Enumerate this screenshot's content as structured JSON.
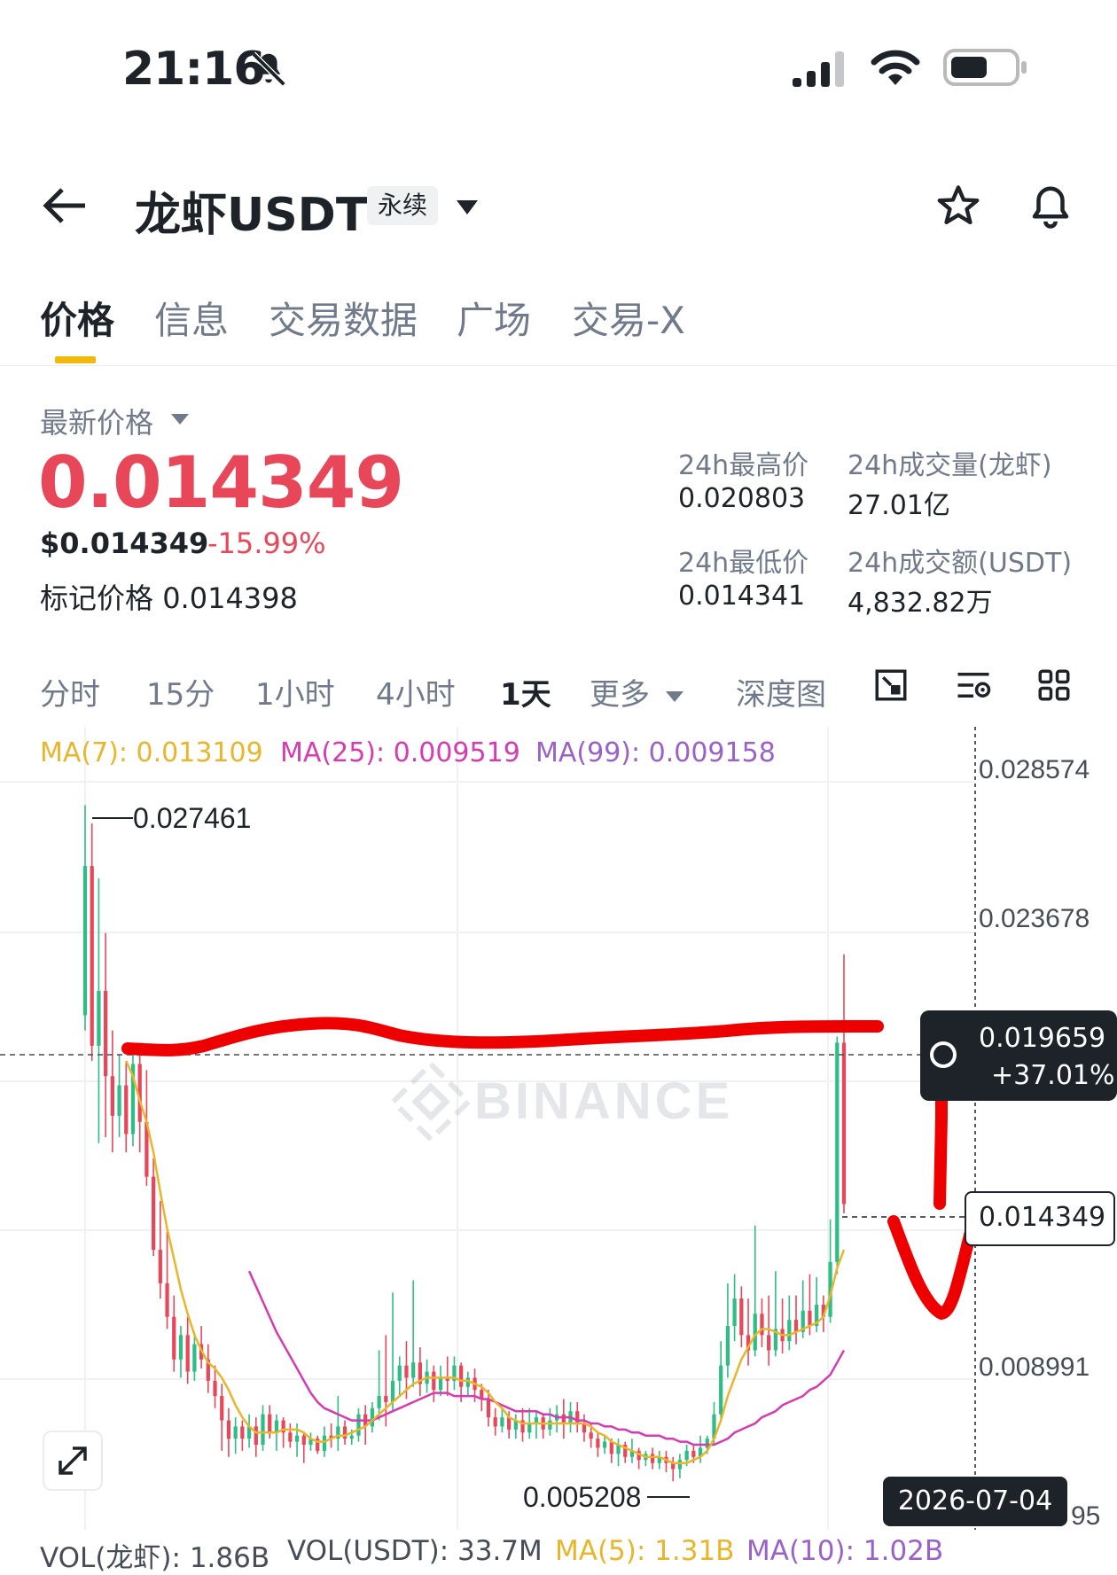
{
  "status_bar": {
    "time": "21:16"
  },
  "header": {
    "title": "龙虾USDT",
    "badge": "永续"
  },
  "tabs": [
    {
      "label": "价格",
      "active": true
    },
    {
      "label": "信息"
    },
    {
      "label": "交易数据"
    },
    {
      "label": "广场"
    },
    {
      "label": "交易-X"
    }
  ],
  "price": {
    "latest_label": "最新价格",
    "last": "0.014349",
    "usd": "$0.014349",
    "change": "-15.99%",
    "mark_label": "标记价格",
    "mark_value": "0.014398"
  },
  "stats": {
    "high_label": "24h最高价",
    "high": "0.020803",
    "vol_coin_label": "24h成交量(龙虾)",
    "vol_coin": "27.01亿",
    "low_label": "24h最低价",
    "low": "0.014341",
    "vol_usdt_label": "24h成交额(USDT)",
    "vol_usdt": "4,832.82万"
  },
  "intervals": [
    "分时",
    "15分",
    "1小时",
    "4小时",
    "1天",
    "更多",
    "深度图"
  ],
  "selected_interval": "1天",
  "chart_labels": {
    "ma7": "MA(7): 0.013109",
    "ma25": "MA(25): 0.009519",
    "ma99": "MA(99): 0.009158",
    "watermark": "BINANCE",
    "high_marker": "0.027461",
    "low_marker": "0.005208",
    "crosshair_price": "0.019659",
    "crosshair_pct": "+37.01%",
    "last_price": "0.014349",
    "date": "2026-07-04",
    "y_ticks": [
      "0.028574",
      "0.023678",
      "0.008991",
      "95"
    ],
    "vol_coin": "VOL(龙虾): 1.86B",
    "vol_usdt": "VOL(USDT): 33.7M",
    "vol_ma5": "MA(5): 1.31B",
    "vol_ma10": "MA(10): 1.02B"
  },
  "colors": {
    "up": "#2ebd85",
    "down": "#e8475a",
    "ma7": "#e9b52b",
    "ma25": "#d63bb0",
    "ma99": "#9a61c9",
    "accent": "#f0b90b",
    "annotation": "#ee0000"
  },
  "chart_data": {
    "type": "candlestick",
    "y_axis_ticks": [
      0.028574,
      0.023678,
      0.008991
    ],
    "high_marker": 0.027461,
    "low_marker": 0.005208,
    "crosshair": 0.019659,
    "last": 0.014349,
    "candles": [
      [
        0.0205,
        0.0254,
        0.02,
        0.0274
      ],
      [
        0.0254,
        0.0195,
        0.019,
        0.0268
      ],
      [
        0.0195,
        0.0213,
        0.0163,
        0.025
      ],
      [
        0.0213,
        0.0185,
        0.0165,
        0.0232
      ],
      [
        0.0185,
        0.0172,
        0.016,
        0.02
      ],
      [
        0.0172,
        0.0182,
        0.0165,
        0.0192
      ],
      [
        0.0182,
        0.0166,
        0.016,
        0.019
      ],
      [
        0.0166,
        0.0189,
        0.0162,
        0.0196
      ],
      [
        0.0189,
        0.017,
        0.016,
        0.0194
      ],
      [
        0.017,
        0.0152,
        0.0149,
        0.0187
      ],
      [
        0.0152,
        0.0128,
        0.0126,
        0.0158
      ],
      [
        0.0128,
        0.0117,
        0.0112,
        0.0144
      ],
      [
        0.0117,
        0.0106,
        0.0102,
        0.0134
      ],
      [
        0.0106,
        0.0092,
        0.0088,
        0.0113
      ],
      [
        0.0092,
        0.01,
        0.0086,
        0.0103
      ],
      [
        0.01,
        0.0088,
        0.0084,
        0.0106
      ],
      [
        0.0088,
        0.0097,
        0.0085,
        0.0101
      ],
      [
        0.0097,
        0.0092,
        0.0089,
        0.0103
      ],
      [
        0.0092,
        0.0085,
        0.0081,
        0.0097
      ],
      [
        0.0085,
        0.008,
        0.0076,
        0.009
      ],
      [
        0.008,
        0.0072,
        0.0062,
        0.0084
      ],
      [
        0.0072,
        0.0066,
        0.006,
        0.0076
      ],
      [
        0.0066,
        0.007,
        0.0061,
        0.0073
      ],
      [
        0.007,
        0.0066,
        0.0062,
        0.0072
      ],
      [
        0.0066,
        0.007,
        0.0063,
        0.0074
      ],
      [
        0.007,
        0.0064,
        0.006,
        0.0073
      ],
      [
        0.0064,
        0.0074,
        0.0062,
        0.0077
      ],
      [
        0.0074,
        0.0068,
        0.0066,
        0.0077
      ],
      [
        0.0068,
        0.0072,
        0.0062,
        0.0074
      ],
      [
        0.0072,
        0.0068,
        0.0063,
        0.0073
      ],
      [
        0.0068,
        0.0065,
        0.0063,
        0.0071
      ],
      [
        0.0065,
        0.0067,
        0.006,
        0.0071
      ],
      [
        0.0067,
        0.0064,
        0.0058,
        0.0068
      ],
      [
        0.0064,
        0.0066,
        0.0062,
        0.0068
      ],
      [
        0.0066,
        0.0062,
        0.0061,
        0.0067
      ],
      [
        0.0062,
        0.0067,
        0.006,
        0.007
      ],
      [
        0.0067,
        0.0066,
        0.0063,
        0.0071
      ],
      [
        0.0066,
        0.007,
        0.0062,
        0.008
      ],
      [
        0.007,
        0.0066,
        0.0064,
        0.0072
      ],
      [
        0.0066,
        0.0067,
        0.0064,
        0.0069
      ],
      [
        0.0067,
        0.0074,
        0.0065,
        0.0076
      ],
      [
        0.0074,
        0.007,
        0.0064,
        0.0077
      ],
      [
        0.007,
        0.0076,
        0.0068,
        0.0078
      ],
      [
        0.0076,
        0.008,
        0.0072,
        0.0095
      ],
      [
        0.008,
        0.0078,
        0.007,
        0.01
      ],
      [
        0.0078,
        0.0085,
        0.0075,
        0.0114
      ],
      [
        0.0085,
        0.009,
        0.008,
        0.0093
      ],
      [
        0.009,
        0.0086,
        0.0079,
        0.0098
      ],
      [
        0.0086,
        0.0091,
        0.0083,
        0.0118
      ],
      [
        0.0091,
        0.0084,
        0.008,
        0.0096
      ],
      [
        0.0084,
        0.0088,
        0.0081,
        0.0092
      ],
      [
        0.0088,
        0.0082,
        0.0078,
        0.009
      ],
      [
        0.0082,
        0.0086,
        0.008,
        0.009
      ],
      [
        0.0086,
        0.0085,
        0.008,
        0.0093
      ],
      [
        0.0085,
        0.009,
        0.0082,
        0.0093
      ],
      [
        0.009,
        0.0083,
        0.0078,
        0.0091
      ],
      [
        0.0083,
        0.0086,
        0.008,
        0.0088
      ],
      [
        0.0086,
        0.0082,
        0.0078,
        0.0089
      ],
      [
        0.0082,
        0.0079,
        0.0075,
        0.0084
      ],
      [
        0.0079,
        0.0073,
        0.007,
        0.0082
      ],
      [
        0.0073,
        0.007,
        0.0067,
        0.0076
      ],
      [
        0.007,
        0.0073,
        0.0068,
        0.0076
      ],
      [
        0.0073,
        0.0069,
        0.0066,
        0.0075
      ],
      [
        0.0069,
        0.0072,
        0.0066,
        0.0074
      ],
      [
        0.0072,
        0.0068,
        0.0065,
        0.0076
      ],
      [
        0.0068,
        0.0071,
        0.0066,
        0.0076
      ],
      [
        0.0071,
        0.0073,
        0.0066,
        0.0075
      ],
      [
        0.0073,
        0.0069,
        0.0066,
        0.0074
      ],
      [
        0.0069,
        0.0072,
        0.0067,
        0.0076
      ],
      [
        0.0072,
        0.0074,
        0.0068,
        0.0077
      ],
      [
        0.0074,
        0.0071,
        0.0066,
        0.0079
      ],
      [
        0.0071,
        0.0075,
        0.0068,
        0.0078
      ],
      [
        0.0075,
        0.0071,
        0.0068,
        0.0078
      ],
      [
        0.0071,
        0.0068,
        0.0065,
        0.0074
      ],
      [
        0.0068,
        0.0066,
        0.0063,
        0.0071
      ],
      [
        0.0066,
        0.0063,
        0.006,
        0.0068
      ],
      [
        0.0063,
        0.0065,
        0.0061,
        0.0067
      ],
      [
        0.0065,
        0.0061,
        0.0058,
        0.0066
      ],
      [
        0.0061,
        0.0064,
        0.0057,
        0.0066
      ],
      [
        0.0064,
        0.006,
        0.0058,
        0.0065
      ],
      [
        0.006,
        0.0062,
        0.0058,
        0.0066
      ],
      [
        0.0062,
        0.0059,
        0.0056,
        0.0063
      ],
      [
        0.0059,
        0.0061,
        0.0057,
        0.0062
      ],
      [
        0.0061,
        0.0058,
        0.0056,
        0.0063
      ],
      [
        0.0058,
        0.006,
        0.0056,
        0.0062
      ],
      [
        0.006,
        0.0058,
        0.0055,
        0.0062
      ],
      [
        0.0058,
        0.0056,
        0.0052,
        0.006
      ],
      [
        0.0056,
        0.0059,
        0.0053,
        0.0061
      ],
      [
        0.0059,
        0.0062,
        0.0057,
        0.0064
      ],
      [
        0.0062,
        0.006,
        0.0058,
        0.0064
      ],
      [
        0.006,
        0.0063,
        0.0058,
        0.0067
      ],
      [
        0.0063,
        0.0066,
        0.0061,
        0.0067
      ],
      [
        0.0066,
        0.0074,
        0.0064,
        0.0078
      ],
      [
        0.0074,
        0.009,
        0.0072,
        0.0098
      ],
      [
        0.009,
        0.0103,
        0.0086,
        0.0117
      ],
      [
        0.0103,
        0.0112,
        0.0098,
        0.012
      ],
      [
        0.0112,
        0.01,
        0.0096,
        0.0116
      ],
      [
        0.01,
        0.0095,
        0.009,
        0.0112
      ],
      [
        0.0095,
        0.0107,
        0.0093,
        0.0136
      ],
      [
        0.0107,
        0.01,
        0.0096,
        0.0112
      ],
      [
        0.01,
        0.0095,
        0.009,
        0.0113
      ],
      [
        0.0095,
        0.0102,
        0.0093,
        0.0121
      ],
      [
        0.0102,
        0.0098,
        0.0094,
        0.0112
      ],
      [
        0.0098,
        0.0105,
        0.0095,
        0.0113
      ],
      [
        0.0105,
        0.0101,
        0.0097,
        0.0113
      ],
      [
        0.0101,
        0.0108,
        0.0099,
        0.0118
      ],
      [
        0.0108,
        0.0103,
        0.01,
        0.012
      ],
      [
        0.0103,
        0.011,
        0.0101,
        0.0119
      ],
      [
        0.011,
        0.0106,
        0.0101,
        0.0113
      ],
      [
        0.0106,
        0.0124,
        0.0104,
        0.0138
      ],
      [
        0.0124,
        0.0196,
        0.012,
        0.0198
      ],
      [
        0.0196,
        0.0143,
        0.014,
        0.0225
      ]
    ],
    "ma7": [
      null,
      null,
      null,
      null,
      null,
      null,
      0.019,
      0.0185,
      0.0177,
      0.017,
      0.016,
      0.0147,
      0.0135,
      0.0125,
      0.0115,
      0.0107,
      0.01,
      0.0095,
      0.0091,
      0.0089,
      0.0086,
      0.0082,
      0.0077,
      0.0073,
      0.007,
      0.0068,
      0.0068,
      0.0068,
      0.0068,
      0.0069,
      0.0069,
      0.0069,
      0.0068,
      0.0066,
      0.0065,
      0.0065,
      0.0066,
      0.0067,
      0.0067,
      0.0068,
      0.0069,
      0.007,
      0.0072,
      0.0074,
      0.0076,
      0.0078,
      0.008,
      0.0082,
      0.0084,
      0.0085,
      0.0086,
      0.0086,
      0.0086,
      0.0086,
      0.0086,
      0.0085,
      0.0085,
      0.0084,
      0.0083,
      0.0081,
      0.0078,
      0.0076,
      0.0073,
      0.0072,
      0.0071,
      0.0071,
      0.0071,
      0.0071,
      0.0071,
      0.0071,
      0.0071,
      0.0071,
      0.0071,
      0.0071,
      0.007,
      0.0068,
      0.0067,
      0.0065,
      0.0064,
      0.0063,
      0.0062,
      0.0061,
      0.006,
      0.006,
      0.006,
      0.0059,
      0.0058,
      0.0058,
      0.0058,
      0.0059,
      0.006,
      0.0062,
      0.0066,
      0.0072,
      0.008,
      0.0086,
      0.0092,
      0.0096,
      0.01,
      0.0102,
      0.0102,
      0.0101,
      0.01,
      0.01,
      0.0101,
      0.0102,
      0.0103,
      0.0104,
      0.0106,
      0.0113,
      0.0122,
      0.0128
    ],
    "ma25": [
      null,
      null,
      null,
      null,
      null,
      null,
      null,
      null,
      null,
      null,
      null,
      null,
      null,
      null,
      null,
      null,
      null,
      null,
      null,
      null,
      null,
      null,
      null,
      null,
      0.0121,
      0.0116,
      0.0111,
      0.0106,
      0.0101,
      0.0097,
      0.0093,
      0.0089,
      0.0085,
      0.0081,
      0.0078,
      0.0076,
      0.0075,
      0.0074,
      0.0073,
      0.0072,
      0.0072,
      0.0072,
      0.0072,
      0.0073,
      0.0074,
      0.0075,
      0.0076,
      0.0077,
      0.0078,
      0.0079,
      0.008,
      0.0081,
      0.0081,
      0.0081,
      0.008,
      0.008,
      0.008,
      0.008,
      0.0079,
      0.0079,
      0.0078,
      0.0077,
      0.0076,
      0.0075,
      0.0075,
      0.0075,
      0.0075,
      0.0074,
      0.0074,
      0.0073,
      0.0073,
      0.0073,
      0.0072,
      0.0072,
      0.0071,
      0.0071,
      0.007,
      0.007,
      0.0069,
      0.0069,
      0.0068,
      0.0068,
      0.0067,
      0.0067,
      0.0067,
      0.0066,
      0.0066,
      0.0065,
      0.0065,
      0.0064,
      0.0064,
      0.0064,
      0.0064,
      0.0065,
      0.0066,
      0.0068,
      0.0069,
      0.007,
      0.0071,
      0.0073,
      0.0074,
      0.0075,
      0.0077,
      0.0078,
      0.0079,
      0.008,
      0.0082,
      0.0083,
      0.0085,
      0.0087,
      0.0091,
      0.0095
    ]
  }
}
